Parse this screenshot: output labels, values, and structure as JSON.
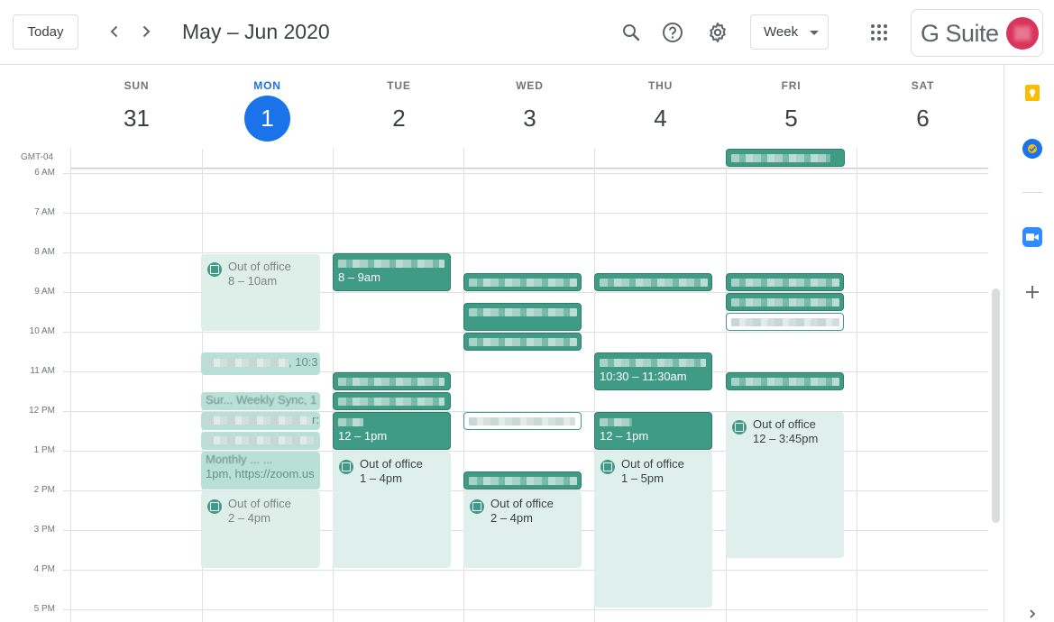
{
  "header": {
    "today_label": "Today",
    "prev_icon": "chevron-left-icon",
    "next_icon": "chevron-right-icon",
    "range_title": "May – Jun 2020",
    "search_icon": "search-icon",
    "help_icon": "help-icon",
    "settings_icon": "gear-icon",
    "view_label": "Week",
    "apps_icon": "apps-grid-icon",
    "brand": "G Suite"
  },
  "days": [
    {
      "name": "SUN",
      "num": "31"
    },
    {
      "name": "MON",
      "num": "1"
    },
    {
      "name": "TUE",
      "num": "2"
    },
    {
      "name": "WED",
      "num": "3"
    },
    {
      "name": "THU",
      "num": "4"
    },
    {
      "name": "FRI",
      "num": "5"
    },
    {
      "name": "SAT",
      "num": "6"
    }
  ],
  "timezone": "GMT-04",
  "hours": [
    "6 AM",
    "7 AM",
    "8 AM",
    "9 AM",
    "10 AM",
    "11 AM",
    "12 PM",
    "1 PM",
    "2 PM",
    "3 PM",
    "4 PM",
    "5 PM"
  ],
  "events": {
    "mon_ooo1": {
      "title": "Out of office",
      "time": "8 – 10am"
    },
    "mon_e2": {
      "tail": ", 10:3"
    },
    "mon_e3": {
      "tail": "Sur... Weekly Sync, 1"
    },
    "mon_e4": {
      "tail": "r:"
    },
    "mon_e6": {
      "line1": "Monthly ... ...",
      "line2": "1pm, https://zoom.us"
    },
    "mon_ooo2": {
      "title": "Out of office",
      "time": "2 – 4pm"
    },
    "tue_e1": {
      "time": "8 – 9am"
    },
    "tue_e4": {
      "time": "12 – 1pm"
    },
    "tue_ooo": {
      "title": "Out of office",
      "time": "1 – 4pm"
    },
    "wed_ooo": {
      "title": "Out of office",
      "time": "2 – 4pm"
    },
    "thu_e2": {
      "time": "10:30 – 11:30am"
    },
    "thu_e3": {
      "time": "12 – 1pm"
    },
    "thu_ooo": {
      "title": "Out of office",
      "time": "1 – 5pm"
    },
    "fri_ooo": {
      "title": "Out of office",
      "time": "12 – 3:45pm"
    }
  },
  "rail": {
    "keep_icon": "keep-bulb-icon",
    "tasks_icon": "tasks-check-icon",
    "zoom_icon": "zoom-camera-icon",
    "add_icon": "plus-icon"
  },
  "colors": {
    "accent": "#1a73e8",
    "event": "#3f9b85",
    "ooo_bg": "#dff0ec"
  }
}
